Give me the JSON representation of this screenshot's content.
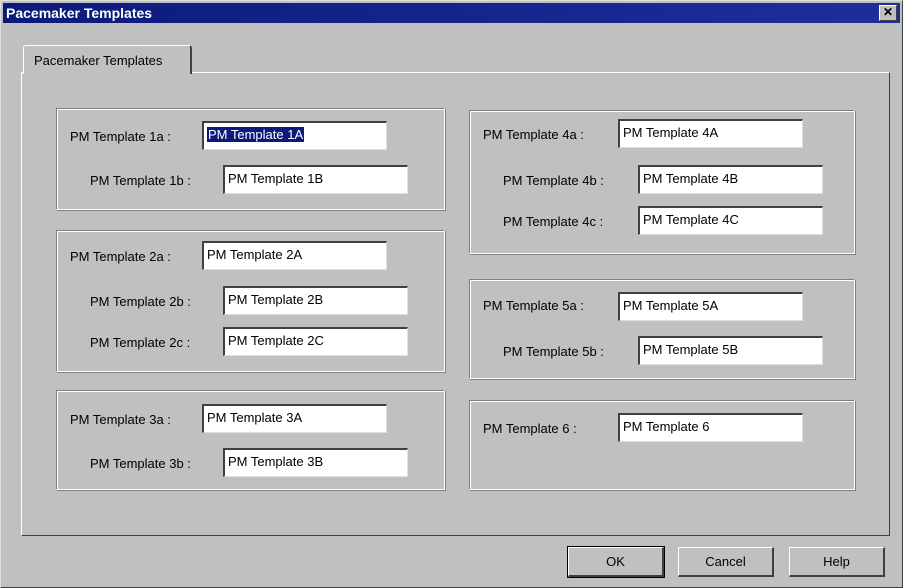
{
  "window": {
    "title": "Pacemaker Templates",
    "close_glyph": "✕",
    "close_icon": "close-icon"
  },
  "tab": {
    "label": "Pacemaker Templates"
  },
  "groups": [
    {
      "rows": [
        {
          "label": "PM Template 1a :",
          "value": "PM Template 1A",
          "selected": true
        },
        {
          "label": "PM Template 1b :",
          "value": "PM Template 1B"
        }
      ]
    },
    {
      "rows": [
        {
          "label": "PM Template 2a :",
          "value": "PM Template 2A"
        },
        {
          "label": "PM Template 2b :",
          "value": "PM Template 2B"
        },
        {
          "label": "PM Template 2c :",
          "value": "PM Template 2C"
        }
      ]
    },
    {
      "rows": [
        {
          "label": "PM Template 3a :",
          "value": "PM Template 3A"
        },
        {
          "label": "PM Template 3b :",
          "value": "PM Template 3B"
        }
      ]
    },
    {
      "rows": [
        {
          "label": "PM Template 4a :",
          "value": "PM Template 4A"
        },
        {
          "label": "PM Template 4b :",
          "value": "PM Template 4B"
        },
        {
          "label": "PM Template 4c :",
          "value": "PM Template 4C"
        }
      ]
    },
    {
      "rows": [
        {
          "label": "PM Template 5a :",
          "value": "PM Template 5A"
        },
        {
          "label": "PM Template 5b :",
          "value": "PM Template 5B"
        }
      ]
    },
    {
      "rows": [
        {
          "label": "PM Template 6 :",
          "value": "PM Template 6"
        }
      ]
    }
  ],
  "buttons": {
    "ok": "OK",
    "cancel": "Cancel",
    "help": "Help"
  },
  "colors": {
    "titlebar": "#0b1a7a",
    "face": "#c0c0c0",
    "selection": "#0b1a7a"
  }
}
